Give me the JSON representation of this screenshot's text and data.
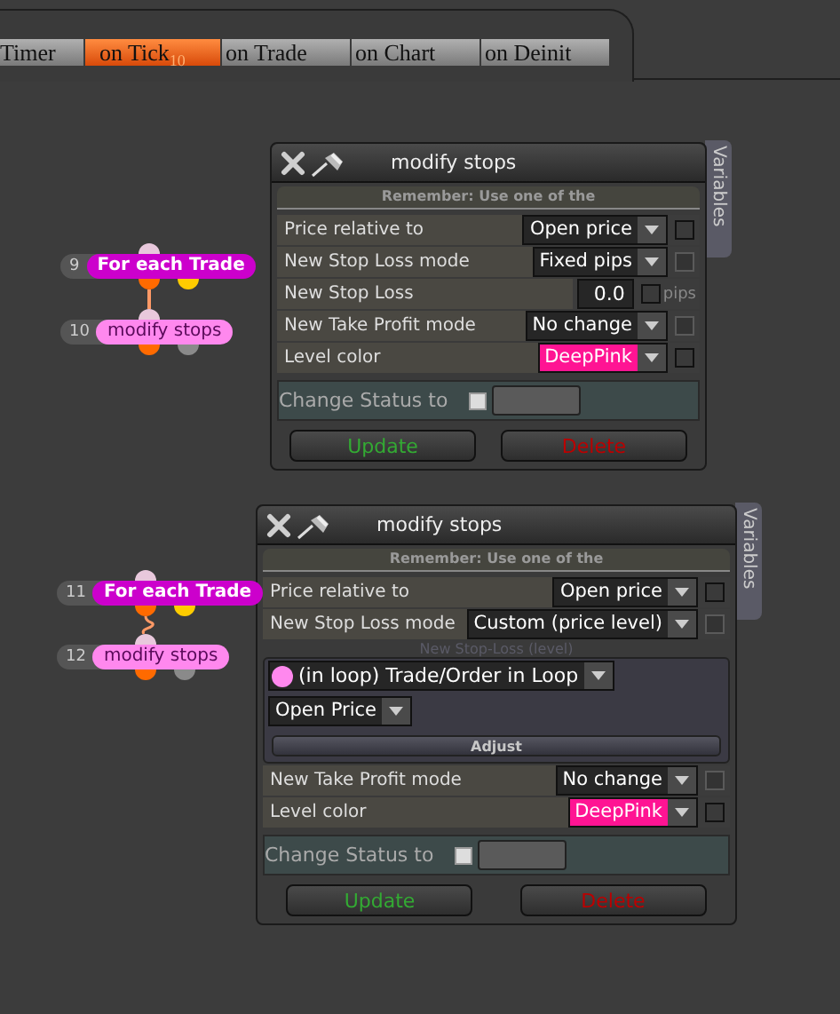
{
  "tabs": [
    {
      "label": "Timer",
      "selected": false
    },
    {
      "label": "on Tick",
      "badge": "10",
      "selected": true
    },
    {
      "label": "on Trade",
      "selected": false
    },
    {
      "label": "on Chart",
      "selected": false
    },
    {
      "label": "on Deinit",
      "selected": false
    }
  ],
  "flows": [
    {
      "nodes": [
        {
          "number": "9",
          "label": "For each Trade",
          "kind": "loop",
          "color": "#cc00cc"
        },
        {
          "number": "10",
          "label": "modify stops",
          "kind": "action",
          "color": "#ff88ee"
        }
      ]
    },
    {
      "nodes": [
        {
          "number": "11",
          "label": "For each Trade",
          "kind": "loop",
          "color": "#cc00cc"
        },
        {
          "number": "12",
          "label": "modify stops",
          "kind": "action",
          "color": "#ff88ee"
        }
      ]
    }
  ],
  "dialogs": [
    {
      "title": "modify stops",
      "side_tab": "Variables",
      "notice": "Remember: Use one of the",
      "rows": [
        {
          "kind": "dropdown",
          "label": "Price relative to",
          "value": "Open price",
          "disabled": false,
          "checked": false
        },
        {
          "kind": "dropdown",
          "label": "New Stop Loss mode",
          "value": "Fixed pips",
          "disabled": true,
          "checked": false
        },
        {
          "kind": "number",
          "label": "New Stop Loss",
          "value": "0.0",
          "unit": "pips",
          "disabled": false,
          "checked": false
        },
        {
          "kind": "dropdown",
          "label": "New Take Profit mode",
          "value": "No change",
          "disabled": true,
          "checked": false
        },
        {
          "kind": "color",
          "label": "Level color",
          "value": "DeepPink",
          "color": "#ff1493",
          "disabled": false,
          "checked": false
        }
      ],
      "status_label": "Change Status to",
      "status_checked": false,
      "buttons": [
        {
          "label": "Update",
          "kind": "ok"
        },
        {
          "label": "Delete",
          "kind": "danger"
        }
      ]
    },
    {
      "title": "modify stops",
      "side_tab": "Variables",
      "notice": "Remember: Use one of the",
      "rows": [
        {
          "kind": "dropdown",
          "label": "Price relative to",
          "value": "Open price",
          "disabled": false,
          "checked": false
        },
        {
          "kind": "dropdown",
          "label": "New Stop Loss mode",
          "value": "Custom (price level)",
          "disabled": true,
          "checked": false
        },
        {
          "kind": "source",
          "caption": "New Stop-Loss (level)",
          "source": "(in loop) Trade/Order in Loop",
          "color": "#ff88ee",
          "field": "Open Price",
          "action": "Adjust"
        },
        {
          "kind": "dropdown",
          "label": "New Take Profit mode",
          "value": "No change",
          "disabled": true,
          "checked": false
        },
        {
          "kind": "color",
          "label": "Level color",
          "value": "DeepPink",
          "color": "#ff1493",
          "disabled": false,
          "checked": false
        }
      ],
      "status_label": "Change Status to",
      "status_checked": false,
      "buttons": [
        {
          "label": "Update",
          "kind": "ok"
        },
        {
          "label": "Delete",
          "kind": "danger"
        }
      ]
    }
  ]
}
